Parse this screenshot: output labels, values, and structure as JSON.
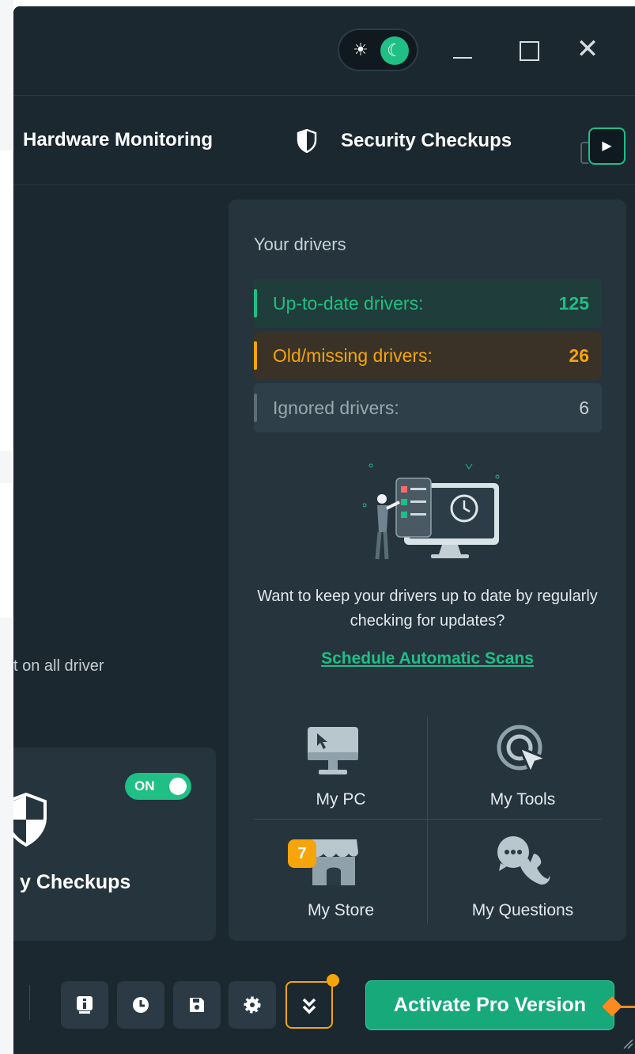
{
  "titlebar": {
    "theme_toggle": {
      "light_icon": "sun-icon",
      "dark_icon": "moon-icon",
      "active": "dark"
    },
    "window_controls": [
      "minimize",
      "maximize",
      "close"
    ]
  },
  "tabs": {
    "hardware": "Hardware Monitoring",
    "security": "Security Checkups",
    "next_icon": "play-arrow-icon"
  },
  "left": {
    "partial_text": "t on all driver",
    "card": {
      "toggle_label": "ON",
      "label": "y Checkups"
    }
  },
  "panel": {
    "title": "Your drivers",
    "rows": [
      {
        "label": "Up-to-date drivers:",
        "count": "125"
      },
      {
        "label": "Old/missing drivers:",
        "count": "26"
      },
      {
        "label": "Ignored drivers:",
        "count": "6"
      }
    ],
    "prompt": "Want to keep your drivers up to date by regularly checking for updates?",
    "link": "Schedule Automatic Scans",
    "tiles": [
      {
        "label": "My PC",
        "icon": "monitor-icon"
      },
      {
        "label": "My Tools",
        "icon": "tools-cursor-icon"
      },
      {
        "label": "My Store",
        "icon": "store-icon",
        "badge": "7"
      },
      {
        "label": "My Questions",
        "icon": "chat-phone-icon"
      }
    ]
  },
  "bottom": {
    "buttons": [
      "info-icon",
      "history-icon",
      "save-icon",
      "settings-icon",
      "expand-more-icon"
    ],
    "activate_label": "Activate Pro Version"
  },
  "colors": {
    "accent": "#1fbf86",
    "warning": "#f5a50a",
    "background": "#1b2830",
    "panel": "#25343d"
  }
}
